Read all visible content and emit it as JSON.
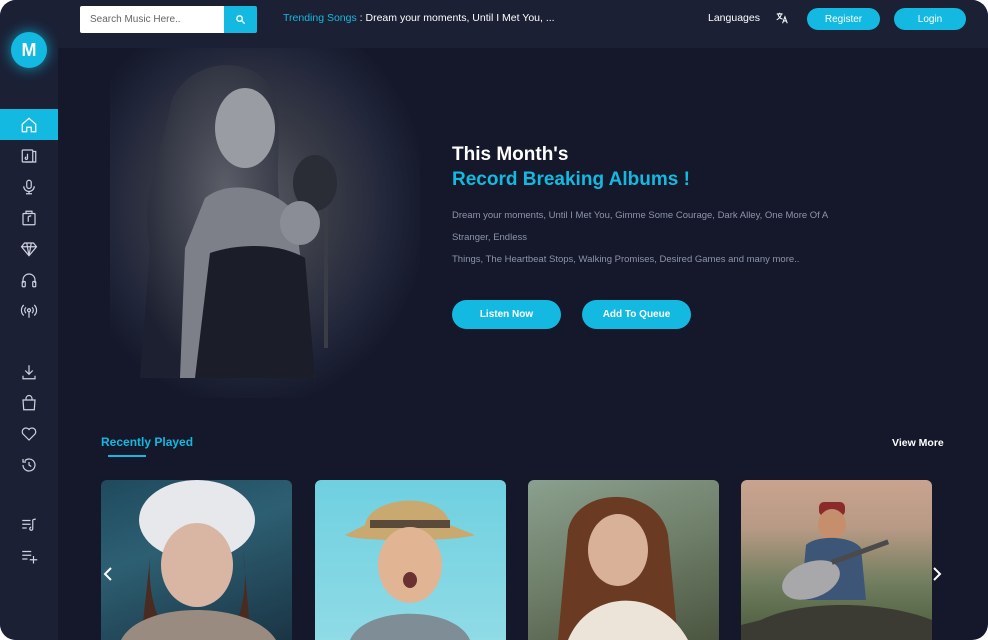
{
  "brand": {
    "logo_letter": "M"
  },
  "search": {
    "placeholder": "Search Music Here.."
  },
  "trending": {
    "label": "Trending Songs",
    "separator": " : ",
    "songs": "Dream your moments, Until I Met You, ..."
  },
  "header": {
    "languages_label": "Languages",
    "register_label": "Register",
    "login_label": "Login"
  },
  "sidebar": {
    "items": [
      {
        "icon": "home-icon",
        "active": true
      },
      {
        "icon": "album-icon",
        "active": false
      },
      {
        "icon": "microphone-icon",
        "active": false
      },
      {
        "icon": "music-box-icon",
        "active": false
      },
      {
        "icon": "diamond-icon",
        "active": false
      },
      {
        "icon": "headphones-icon",
        "active": false
      },
      {
        "icon": "radio-broadcast-icon",
        "active": false
      },
      {
        "icon": "download-icon",
        "active": false
      },
      {
        "icon": "shopping-bag-icon",
        "active": false
      },
      {
        "icon": "heart-icon",
        "active": false
      },
      {
        "icon": "history-icon",
        "active": false
      },
      {
        "icon": "playlist-music-icon",
        "active": false
      },
      {
        "icon": "playlist-add-icon",
        "active": false
      }
    ]
  },
  "hero": {
    "title_line1": "This Month's",
    "title_line2": "Record Breaking Albums !",
    "desc_line1": "Dream your moments, Until I Met You, Gimme Some Courage, Dark Alley, One More Of A",
    "desc_line2": "Stranger, Endless",
    "desc_line3": "Things, The Heartbeat Stops, Walking Promises, Desired Games and many more..",
    "listen_label": "Listen Now",
    "queue_label": "Add To Queue"
  },
  "recently_played": {
    "title": "Recently Played",
    "view_more": "View More"
  },
  "colors": {
    "accent": "#13b9e0",
    "background": "#14182a",
    "panel": "#1b2035",
    "muted_text": "#8e94ab"
  }
}
